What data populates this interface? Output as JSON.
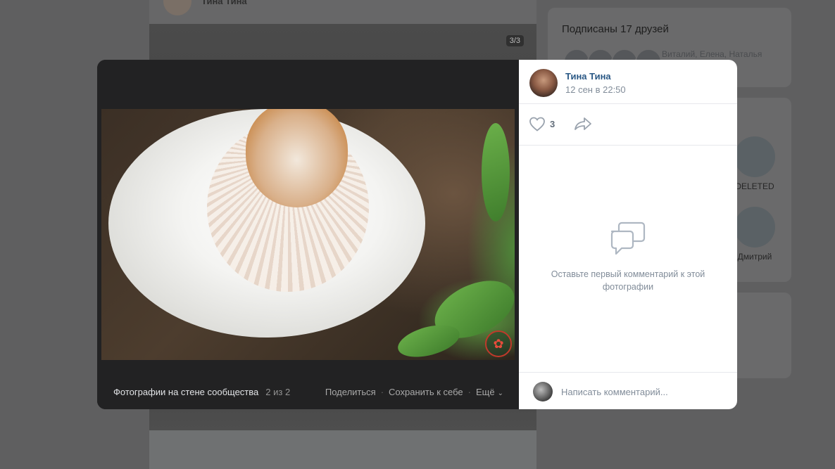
{
  "background": {
    "post_author": "Тина Тина",
    "photo_counter": "3/3",
    "friends_title": "Подписаны 17 друзей",
    "friends_names": "Виталий, Елена, Наталья",
    "people": [
      {
        "name": "DELETED"
      },
      {
        "name": "Дмитрий"
      }
    ]
  },
  "viewer": {
    "footer": {
      "album_title": "Фотографии на стене сообщества",
      "position": "2 из 2",
      "share_label": "Поделиться",
      "save_label": "Сохранить к себе",
      "more_label": "Ещё"
    },
    "author": {
      "name": "Тина Тина",
      "date": "12 сен в 22:50"
    },
    "likes_count": "3",
    "empty_comments_text": "Оставьте первый комментарий к этой фотографии",
    "comment_placeholder": "Написать комментарий...",
    "colors": {
      "link": "#2a5885",
      "muted": "#818c99",
      "dark_bg": "#222223"
    }
  }
}
